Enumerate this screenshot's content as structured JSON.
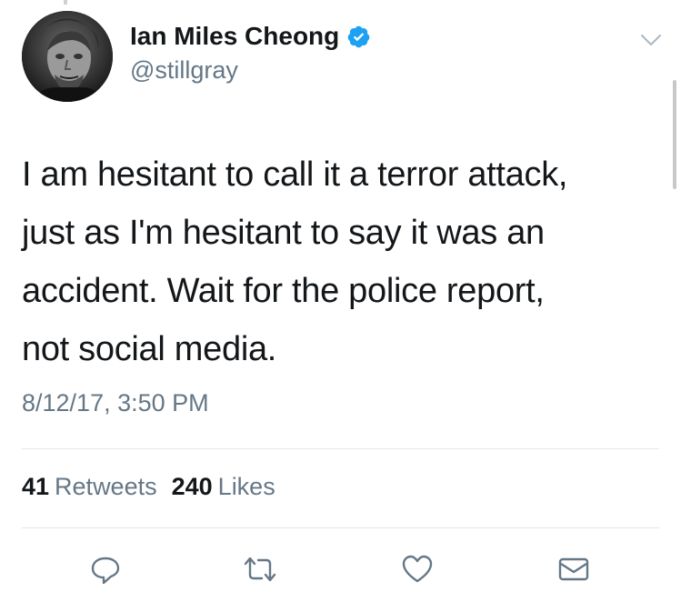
{
  "user": {
    "display_name": "Ian Miles Cheong",
    "handle": "@stillgray",
    "verified": true,
    "avatar_icon": "user-avatar"
  },
  "tweet": {
    "text_lines": [
      "I am hesitant to call it a terror attack,",
      "just as I'm hesitant to say it was an",
      "accident. Wait for the police report,",
      "not social media."
    ],
    "timestamp": "8/12/17, 3:50 PM"
  },
  "stats": {
    "retweets_count": "41",
    "retweets_label": "Retweets",
    "likes_count": "240",
    "likes_label": "Likes"
  },
  "actions": {
    "reply_icon": "reply-icon",
    "retweet_icon": "retweet-icon",
    "like_icon": "heart-icon",
    "dm_icon": "envelope-icon"
  },
  "colors": {
    "text": "#14171a",
    "secondary": "#657786",
    "verified": "#1da1f2",
    "divider": "#e1e8ed"
  }
}
